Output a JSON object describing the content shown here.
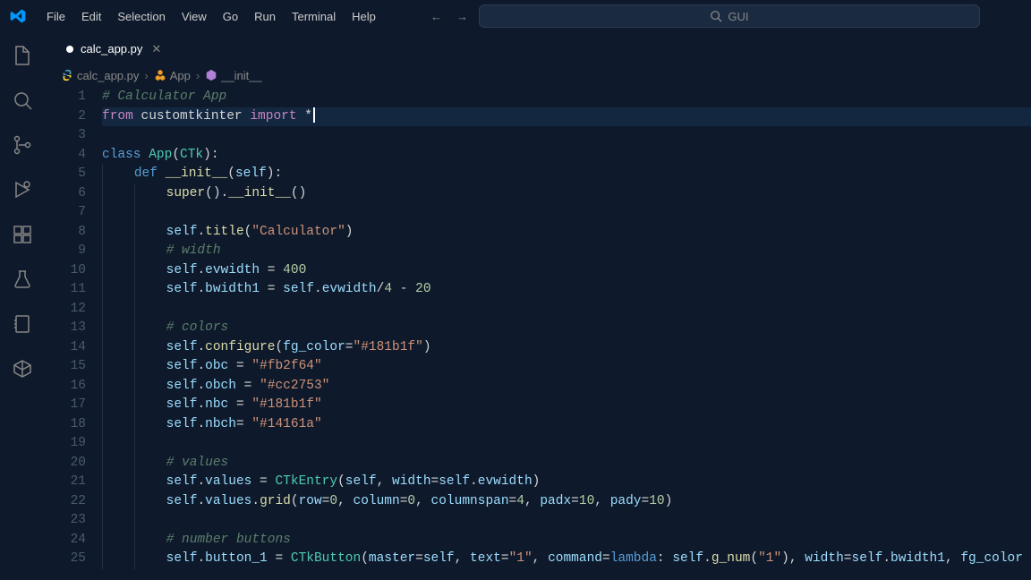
{
  "menu": [
    "File",
    "Edit",
    "Selection",
    "View",
    "Go",
    "Run",
    "Terminal",
    "Help"
  ],
  "search": {
    "placeholder": "GUI"
  },
  "tab": {
    "filename": "calc_app.py",
    "modified": true
  },
  "breadcrumbs": {
    "file": "calc_app.py",
    "class": "App",
    "method": "__init__"
  },
  "code": {
    "lines": [
      {
        "n": 1,
        "indent": 0,
        "tokens": [
          [
            "# Calculator App",
            "c-comment"
          ]
        ]
      },
      {
        "n": 2,
        "indent": 0,
        "hl": true,
        "cursor": true,
        "tokens": [
          [
            "from",
            "c-keyword"
          ],
          [
            " customtkinter ",
            ""
          ],
          [
            "import",
            "c-keyword"
          ],
          [
            " *",
            ""
          ]
        ]
      },
      {
        "n": 3,
        "indent": 0,
        "tokens": []
      },
      {
        "n": 4,
        "indent": 0,
        "tokens": [
          [
            "class",
            "c-keyword2"
          ],
          [
            " ",
            ""
          ],
          [
            "App",
            "c-class"
          ],
          [
            "(",
            "c-punct"
          ],
          [
            "CTk",
            "c-class"
          ],
          [
            "):",
            "c-punct"
          ]
        ]
      },
      {
        "n": 5,
        "indent": 1,
        "tokens": [
          [
            "def",
            "c-keyword2"
          ],
          [
            " ",
            ""
          ],
          [
            "__init__",
            "c-func"
          ],
          [
            "(",
            "c-punct"
          ],
          [
            "self",
            "c-self"
          ],
          [
            "):",
            "c-punct"
          ]
        ]
      },
      {
        "n": 6,
        "indent": 2,
        "tokens": [
          [
            "super",
            "c-builtin"
          ],
          [
            "().",
            "c-punct"
          ],
          [
            "__init__",
            "c-func"
          ],
          [
            "()",
            "c-punct"
          ]
        ]
      },
      {
        "n": 7,
        "indent": 2,
        "tokens": []
      },
      {
        "n": 8,
        "indent": 2,
        "tokens": [
          [
            "self",
            "c-self"
          ],
          [
            ".",
            "c-punct"
          ],
          [
            "title",
            "c-func"
          ],
          [
            "(",
            "c-punct"
          ],
          [
            "\"Calculator\"",
            "c-string"
          ],
          [
            ")",
            "c-punct"
          ]
        ]
      },
      {
        "n": 9,
        "indent": 2,
        "tokens": [
          [
            "# width",
            "c-comment"
          ]
        ]
      },
      {
        "n": 10,
        "indent": 2,
        "tokens": [
          [
            "self",
            "c-self"
          ],
          [
            ".",
            "c-punct"
          ],
          [
            "evwidth",
            "c-prop"
          ],
          [
            " = ",
            "c-op"
          ],
          [
            "400",
            "c-num"
          ]
        ]
      },
      {
        "n": 11,
        "indent": 2,
        "tokens": [
          [
            "self",
            "c-self"
          ],
          [
            ".",
            "c-punct"
          ],
          [
            "bwidth1",
            "c-prop"
          ],
          [
            " = ",
            "c-op"
          ],
          [
            "self",
            "c-self"
          ],
          [
            ".",
            "c-punct"
          ],
          [
            "evwidth",
            "c-prop"
          ],
          [
            "/",
            "c-op"
          ],
          [
            "4",
            "c-num"
          ],
          [
            " - ",
            "c-op"
          ],
          [
            "20",
            "c-num"
          ]
        ]
      },
      {
        "n": 12,
        "indent": 2,
        "tokens": []
      },
      {
        "n": 13,
        "indent": 2,
        "tokens": [
          [
            "# colors",
            "c-comment"
          ]
        ]
      },
      {
        "n": 14,
        "indent": 2,
        "tokens": [
          [
            "self",
            "c-self"
          ],
          [
            ".",
            "c-punct"
          ],
          [
            "configure",
            "c-func"
          ],
          [
            "(",
            "c-punct"
          ],
          [
            "fg_color",
            "c-kwarg"
          ],
          [
            "=",
            "c-op"
          ],
          [
            "\"#181b1f\"",
            "c-string"
          ],
          [
            ")",
            "c-punct"
          ]
        ]
      },
      {
        "n": 15,
        "indent": 2,
        "tokens": [
          [
            "self",
            "c-self"
          ],
          [
            ".",
            "c-punct"
          ],
          [
            "obc",
            "c-prop"
          ],
          [
            " = ",
            "c-op"
          ],
          [
            "\"#fb2f64\"",
            "c-string"
          ]
        ]
      },
      {
        "n": 16,
        "indent": 2,
        "tokens": [
          [
            "self",
            "c-self"
          ],
          [
            ".",
            "c-punct"
          ],
          [
            "obch",
            "c-prop"
          ],
          [
            " = ",
            "c-op"
          ],
          [
            "\"#cc2753\"",
            "c-string"
          ]
        ]
      },
      {
        "n": 17,
        "indent": 2,
        "tokens": [
          [
            "self",
            "c-self"
          ],
          [
            ".",
            "c-punct"
          ],
          [
            "nbc",
            "c-prop"
          ],
          [
            " = ",
            "c-op"
          ],
          [
            "\"#181b1f\"",
            "c-string"
          ]
        ]
      },
      {
        "n": 18,
        "indent": 2,
        "tokens": [
          [
            "self",
            "c-self"
          ],
          [
            ".",
            "c-punct"
          ],
          [
            "nbch",
            "c-prop"
          ],
          [
            "= ",
            "c-op"
          ],
          [
            "\"#14161a\"",
            "c-string"
          ]
        ]
      },
      {
        "n": 19,
        "indent": 2,
        "tokens": []
      },
      {
        "n": 20,
        "indent": 2,
        "tokens": [
          [
            "# values",
            "c-comment"
          ]
        ]
      },
      {
        "n": 21,
        "indent": 2,
        "tokens": [
          [
            "self",
            "c-self"
          ],
          [
            ".",
            "c-punct"
          ],
          [
            "values",
            "c-prop"
          ],
          [
            " = ",
            "c-op"
          ],
          [
            "CTkEntry",
            "c-class"
          ],
          [
            "(",
            "c-punct"
          ],
          [
            "self",
            "c-self"
          ],
          [
            ", ",
            "c-punct"
          ],
          [
            "width",
            "c-kwarg"
          ],
          [
            "=",
            "c-op"
          ],
          [
            "self",
            "c-self"
          ],
          [
            ".",
            "c-punct"
          ],
          [
            "evwidth",
            "c-prop"
          ],
          [
            ")",
            "c-punct"
          ]
        ]
      },
      {
        "n": 22,
        "indent": 2,
        "tokens": [
          [
            "self",
            "c-self"
          ],
          [
            ".",
            "c-punct"
          ],
          [
            "values",
            "c-prop"
          ],
          [
            ".",
            "c-punct"
          ],
          [
            "grid",
            "c-func"
          ],
          [
            "(",
            "c-punct"
          ],
          [
            "row",
            "c-kwarg"
          ],
          [
            "=",
            "c-op"
          ],
          [
            "0",
            "c-num"
          ],
          [
            ", ",
            "c-punct"
          ],
          [
            "column",
            "c-kwarg"
          ],
          [
            "=",
            "c-op"
          ],
          [
            "0",
            "c-num"
          ],
          [
            ", ",
            "c-punct"
          ],
          [
            "columnspan",
            "c-kwarg"
          ],
          [
            "=",
            "c-op"
          ],
          [
            "4",
            "c-num"
          ],
          [
            ", ",
            "c-punct"
          ],
          [
            "padx",
            "c-kwarg"
          ],
          [
            "=",
            "c-op"
          ],
          [
            "10",
            "c-num"
          ],
          [
            ", ",
            "c-punct"
          ],
          [
            "pady",
            "c-kwarg"
          ],
          [
            "=",
            "c-op"
          ],
          [
            "10",
            "c-num"
          ],
          [
            ")",
            "c-punct"
          ]
        ]
      },
      {
        "n": 23,
        "indent": 2,
        "tokens": []
      },
      {
        "n": 24,
        "indent": 2,
        "tokens": [
          [
            "# number buttons",
            "c-comment"
          ]
        ]
      },
      {
        "n": 25,
        "indent": 2,
        "tokens": [
          [
            "self",
            "c-self"
          ],
          [
            ".",
            "c-punct"
          ],
          [
            "button_1",
            "c-prop"
          ],
          [
            " = ",
            "c-op"
          ],
          [
            "CTkButton",
            "c-class"
          ],
          [
            "(",
            "c-punct"
          ],
          [
            "master",
            "c-kwarg"
          ],
          [
            "=",
            "c-op"
          ],
          [
            "self",
            "c-self"
          ],
          [
            ", ",
            "c-punct"
          ],
          [
            "text",
            "c-kwarg"
          ],
          [
            "=",
            "c-op"
          ],
          [
            "\"1\"",
            "c-string"
          ],
          [
            ", ",
            "c-punct"
          ],
          [
            "command",
            "c-kwarg"
          ],
          [
            "=",
            "c-op"
          ],
          [
            "lambda",
            "c-keyword2"
          ],
          [
            ": ",
            "c-punct"
          ],
          [
            "self",
            "c-self"
          ],
          [
            ".",
            "c-punct"
          ],
          [
            "g_num",
            "c-func"
          ],
          [
            "(",
            "c-punct"
          ],
          [
            "\"1\"",
            "c-string"
          ],
          [
            "), ",
            "c-punct"
          ],
          [
            "width",
            "c-kwarg"
          ],
          [
            "=",
            "c-op"
          ],
          [
            "self",
            "c-self"
          ],
          [
            ".",
            "c-punct"
          ],
          [
            "bwidth1",
            "c-prop"
          ],
          [
            ", ",
            "c-punct"
          ],
          [
            "fg_color",
            "c-kwarg"
          ]
        ]
      }
    ]
  }
}
